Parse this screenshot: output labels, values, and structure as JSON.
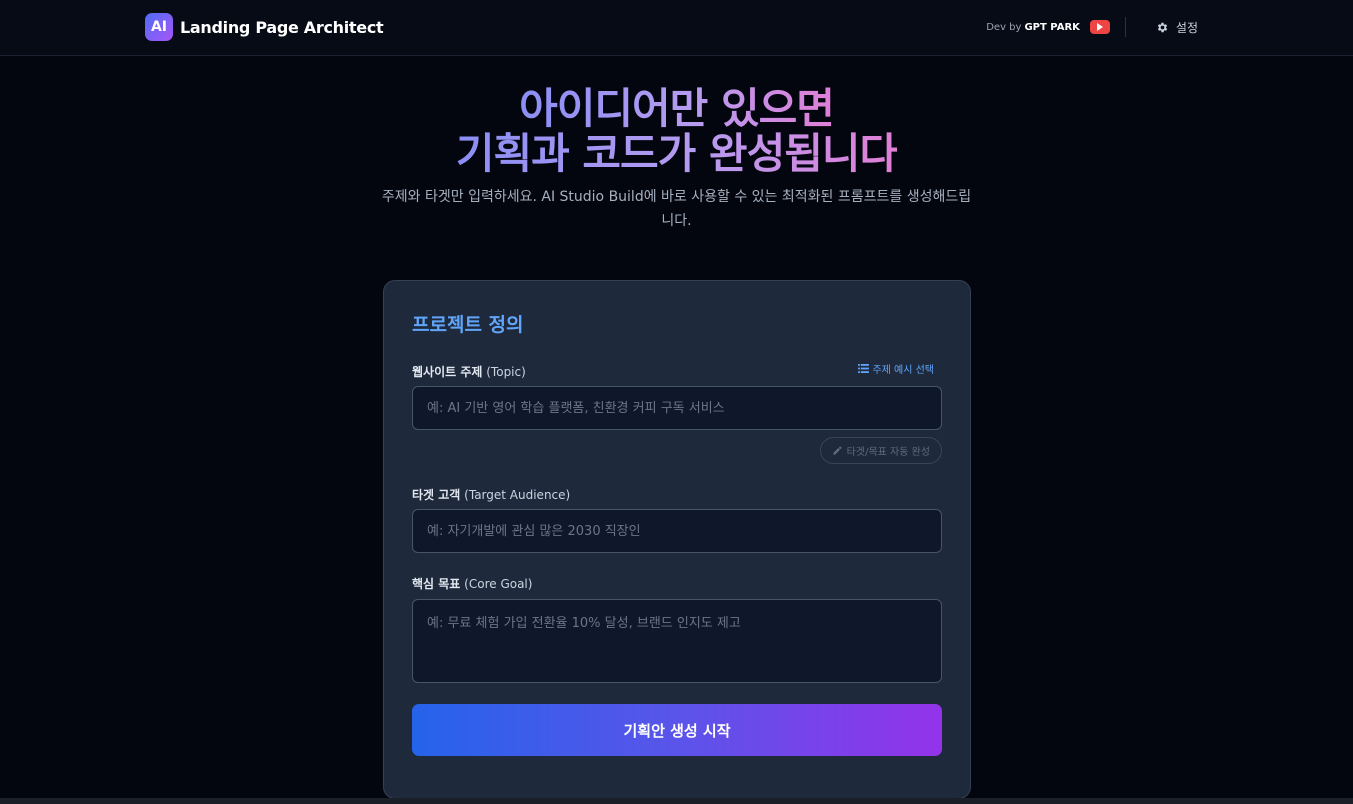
{
  "header": {
    "logo_text": "AI",
    "app_name": "Landing Page Architect",
    "dev_prefix": "Dev by",
    "dev_name": "GPT PARK",
    "youtube_icon": "youtube-icon",
    "settings_icon": "gear-icon",
    "settings_label": "설정"
  },
  "hero": {
    "title_line1": "아이디어만 있으면",
    "title_line2": "기획과 코드가 완성됩니다",
    "subtitle": "주제와 타겟만 입력하세요. AI Studio Build에 바로 사용할 수 있는 최적화된 프롬프트를 생성해드립니다."
  },
  "form": {
    "title": "프로젝트 정의",
    "topic": {
      "label": "웹사이트 주제",
      "label_en": "(Topic)",
      "placeholder": "예: AI 기반 영어 학습 플랫폼, 친환경 커피 구독 서비스",
      "value": ""
    },
    "example_link": "주제 예시 선택",
    "autofill_label": "타겟/목표 자동 완성",
    "audience": {
      "label": "타겟 고객",
      "label_en": "(Target Audience)",
      "placeholder": "예: 자기개발에 관심 많은 2030 직장인",
      "value": ""
    },
    "goal": {
      "label": "핵심 목표",
      "label_en": "(Core Goal)",
      "placeholder": "예: 무료 체험 가입 전환율 10% 달성, 브랜드 인지도 제고",
      "value": ""
    },
    "submit_label": "기획안 생성 시작"
  },
  "colors": {
    "accent_blue": "#60a5fa",
    "gradient_start": "#2563eb",
    "gradient_end": "#9333ea",
    "card_bg": "#1e293b",
    "page_bg": "#03060f"
  }
}
